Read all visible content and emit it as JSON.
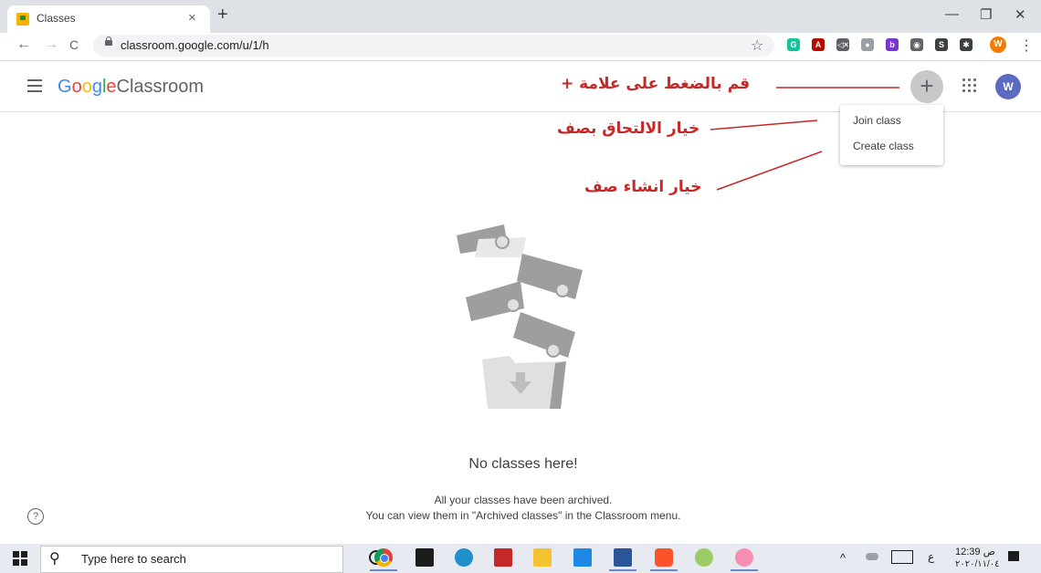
{
  "browser": {
    "tab_title": "Classes",
    "tab_close": "×",
    "new_tab": "+",
    "window_minimize": "—",
    "window_restore": "❐",
    "window_close": "✕",
    "back": "←",
    "forward": "→",
    "reload": "C",
    "url": "classroom.google.com/u/1/h",
    "bookmark_star": "☆",
    "profile_initial": "W",
    "extensions": [
      {
        "name": "grammarly-icon",
        "color": "#15c39a",
        "glyph": "G"
      },
      {
        "name": "acrobat-icon",
        "color": "#b30b00",
        "glyph": "A"
      },
      {
        "name": "mute-icon",
        "color": "#5f6368",
        "glyph": "◁×"
      },
      {
        "name": "ext-icon",
        "color": "#9aa0a6",
        "glyph": "●"
      },
      {
        "name": "b-icon",
        "color": "#7b35d1",
        "glyph": "b"
      },
      {
        "name": "ext2-icon",
        "color": "#5f6368",
        "glyph": "◉"
      },
      {
        "name": "s-icon",
        "color": "#3c4043",
        "glyph": "S"
      },
      {
        "name": "puzzle-icon",
        "color": "#3c4043",
        "glyph": "✱"
      }
    ]
  },
  "classroom": {
    "logo_google_letters": [
      "G",
      "o",
      "o",
      "g",
      "l",
      "e"
    ],
    "logo_product": "Classroom",
    "plus_label": "+",
    "avatar_initial": "W",
    "menu": {
      "join_class": "Join class",
      "create_class": "Create class"
    },
    "empty_title": "No classes here!",
    "empty_line1": "All your classes have been archived.",
    "empty_line2": "You can view them in \"Archived classes\" in the Classroom menu.",
    "help": "?"
  },
  "annotations": {
    "plus_hint": "قم بالضغط على علامة +",
    "join_hint": "خيار الالتحاق بصف",
    "create_hint": "خيار انشاء صف"
  },
  "taskbar": {
    "search_placeholder": "Type here to search",
    "clock_time": "12:39 ص",
    "clock_date": "٢٠٢٠/١١/٠٤",
    "lang": "ع"
  },
  "colors": {
    "annotation_red": "#c62828",
    "avatar": "#5c6bc0",
    "plus_button_bg": "#c8c8c8"
  }
}
